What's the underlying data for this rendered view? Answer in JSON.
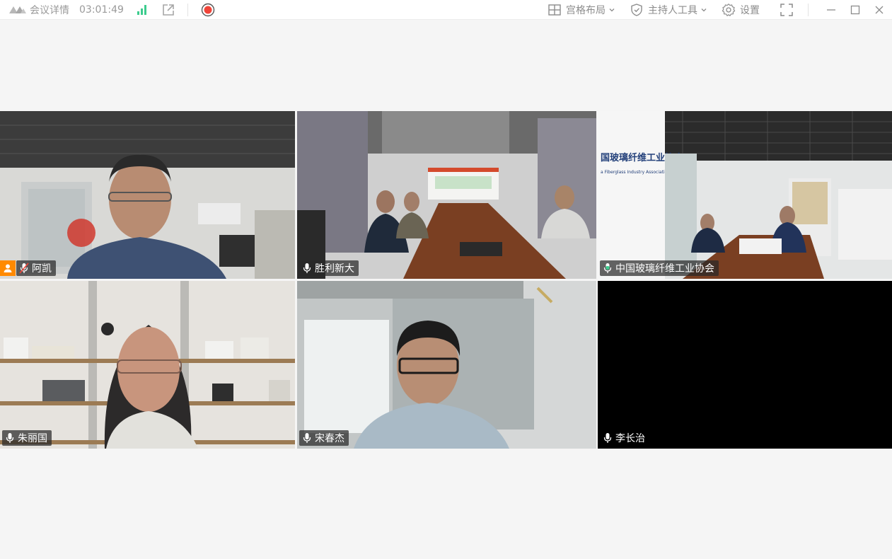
{
  "toolbar": {
    "meeting_details_label": "会议详情",
    "elapsed_time": "03:01:49",
    "layout_label": "宫格布局",
    "host_tools_label": "主持人工具",
    "settings_label": "设置"
  },
  "participants": [
    {
      "name": "阿凯",
      "mic": "muted",
      "is_host": true,
      "speaking": false
    },
    {
      "name": "胜利新大",
      "mic": "on",
      "is_host": false,
      "speaking": false
    },
    {
      "name": "中国玻璃纤维工业协会",
      "mic": "active",
      "is_host": false,
      "speaking": true,
      "wall_sign": "国玻璃纤维工业协会",
      "wall_sign_sub": "a Fiberglass Industry Association"
    },
    {
      "name": "朱丽国",
      "mic": "on",
      "is_host": false,
      "speaking": false
    },
    {
      "name": "宋春杰",
      "mic": "on",
      "is_host": false,
      "speaking": false
    },
    {
      "name": "李长治",
      "mic": "on",
      "is_host": false,
      "speaking": false,
      "video": "off"
    }
  ],
  "colors": {
    "active_speaker_border": "#3dcc8e",
    "host_badge": "#ff8a00",
    "record_dot": "#f0453a",
    "signal_bars": "#3dcc8e"
  }
}
